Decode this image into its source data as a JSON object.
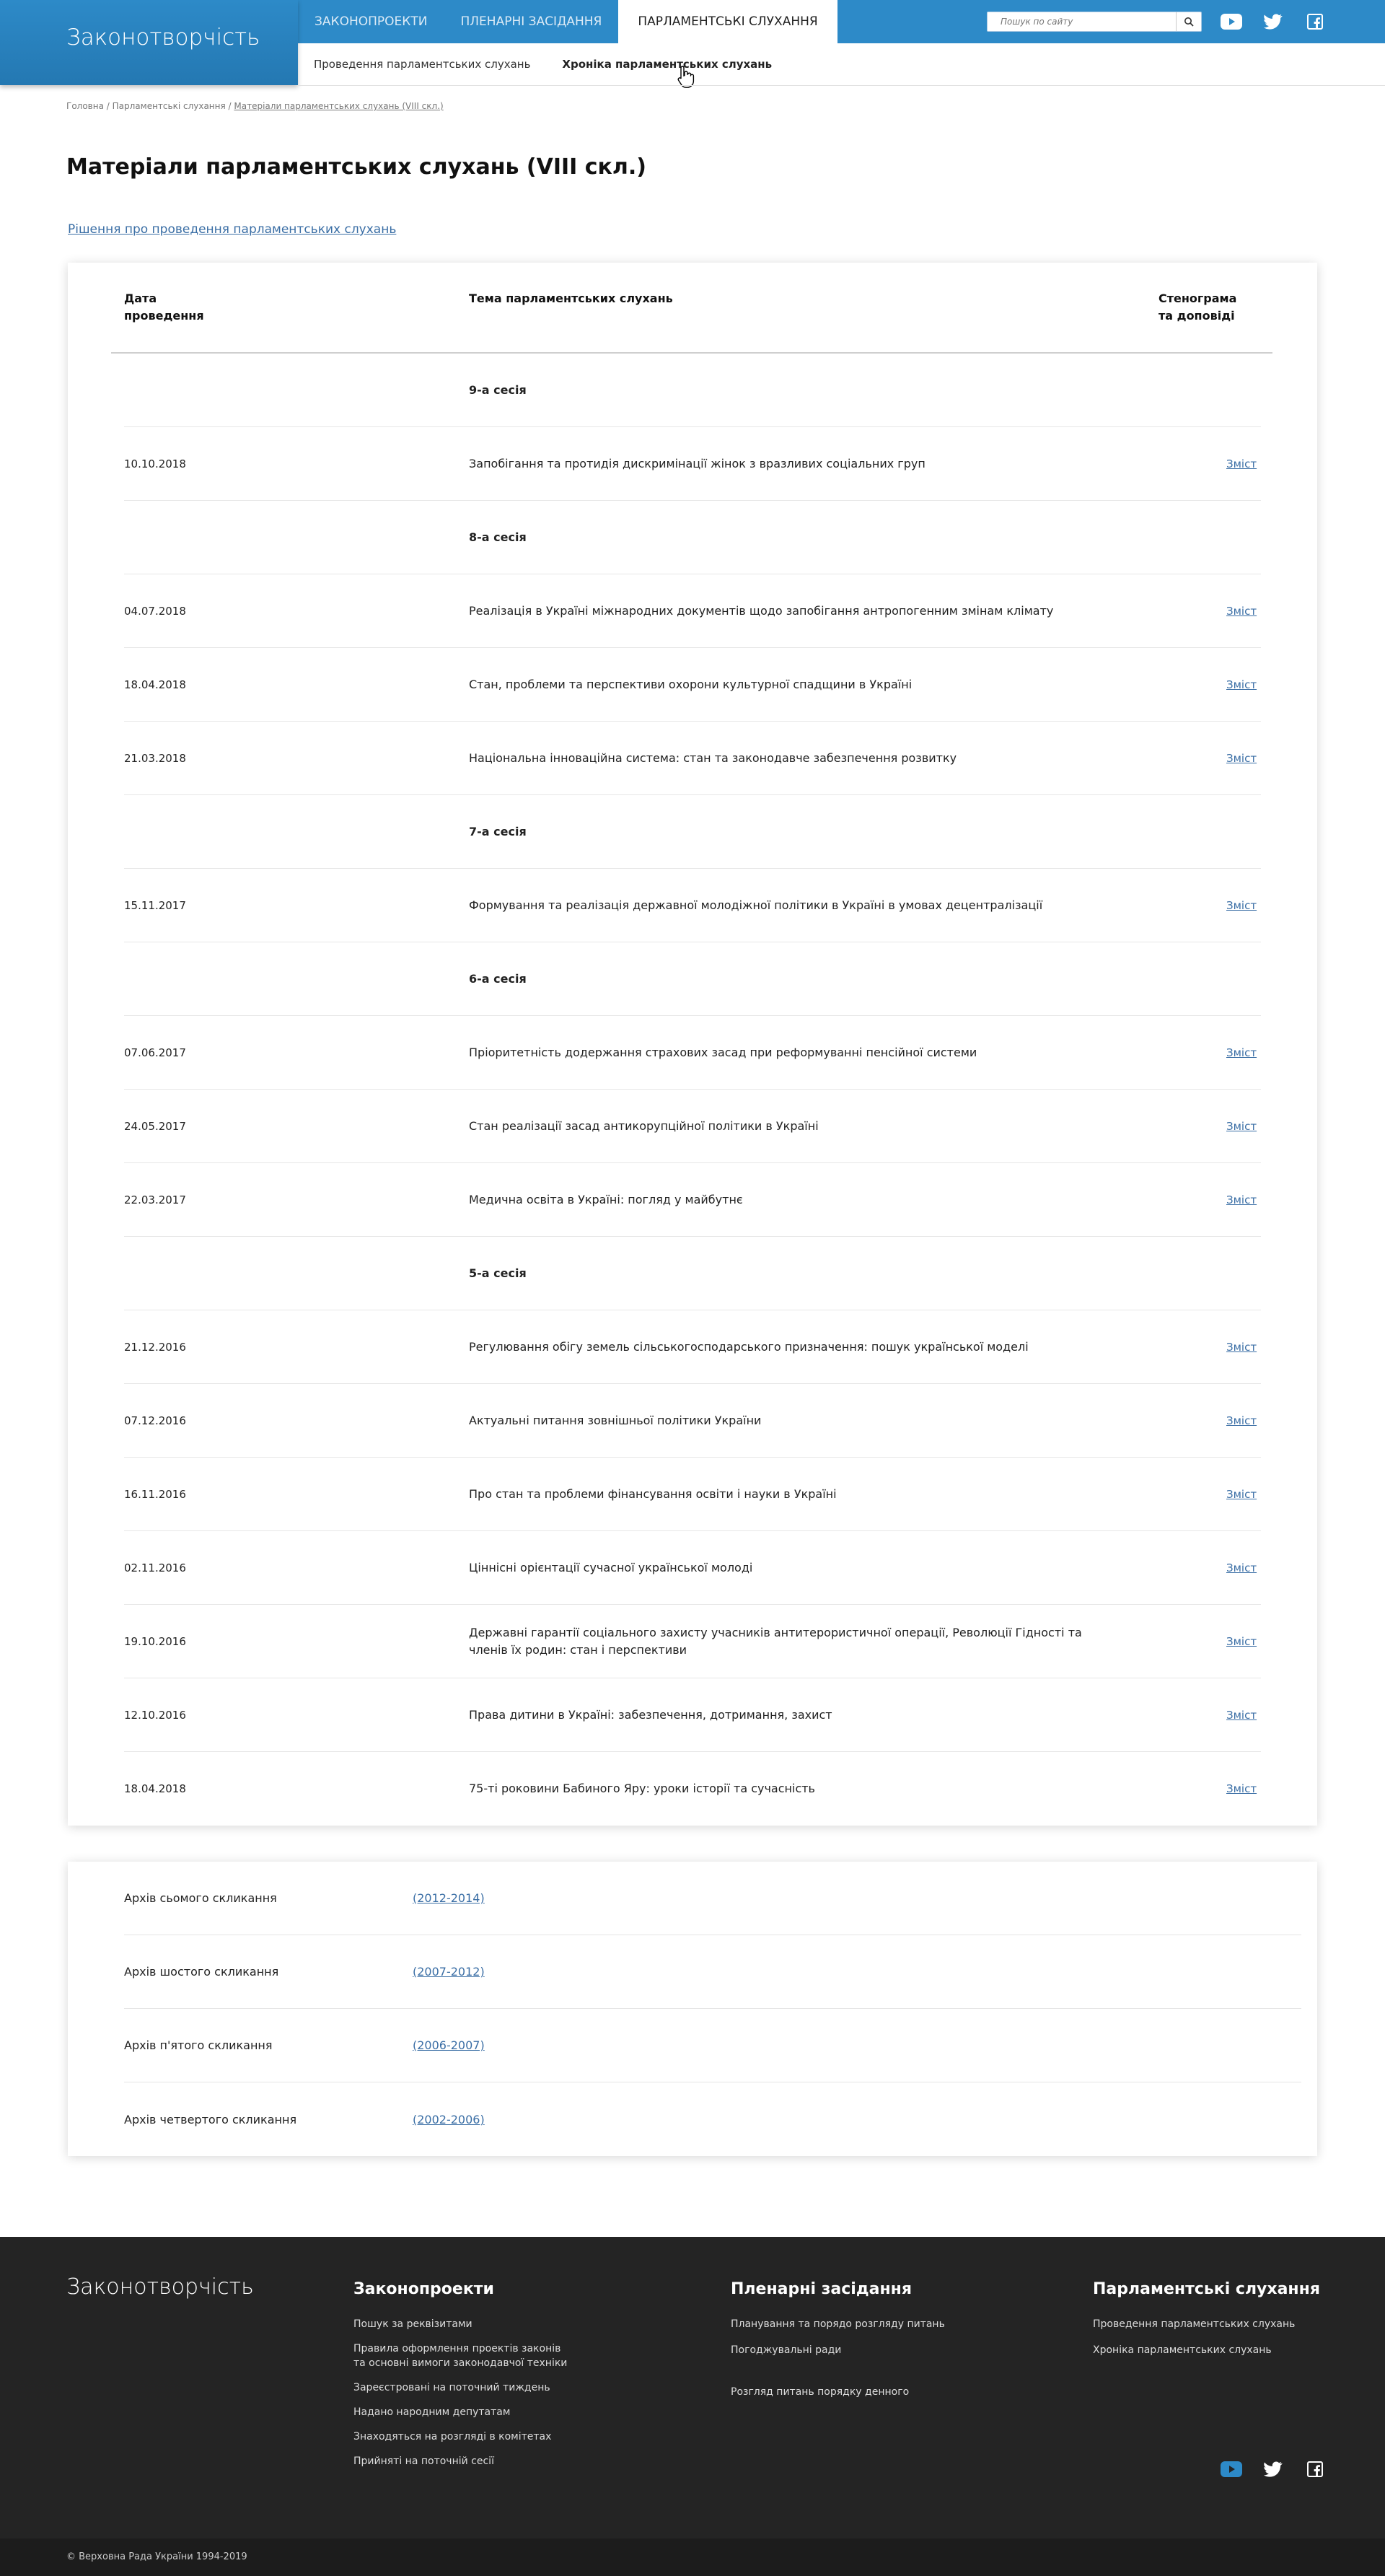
{
  "header": {
    "logo": "Законотворчість",
    "nav": [
      "ЗАКОНОПРОЕКТИ",
      "ПЛЕНАРНІ ЗАСІДАННЯ",
      "ПАРЛАМЕНТСЬКІ СЛУХАННЯ"
    ],
    "search_placeholder": "Пошук по сайту",
    "subnav": [
      "Проведення парламентських слухань",
      "Хроніка парламентських слухань"
    ]
  },
  "breadcrumb": {
    "home": "Головна",
    "section": "Парламентські слухання",
    "current": "Матеріали парламентських слухань (VIII скл.)"
  },
  "page_title": "Матеріали парламентських слухань (VIII скл.)",
  "decision_link": "Рішення про проведення парламентських слухань",
  "table": {
    "col_date_1": "Дата",
    "col_date_2": "проведення",
    "col_topic": "Тема парламентських слухань",
    "col_steno_1": "Стенограма",
    "col_steno_2": "та доповіді",
    "rows": [
      {
        "date": "",
        "topic": "9-а сесія",
        "link": "",
        "session": true
      },
      {
        "date": "10.10.2018",
        "topic": "Запобігання та протидія дискримінації жінок з вразливих соціальних груп",
        "link": "Зміст"
      },
      {
        "date": "",
        "topic": "8-а сесія",
        "link": "",
        "session": true
      },
      {
        "date": "04.07.2018",
        "topic": "Реалізація в Україні міжнародних документів щодо запобігання антропогенним змінам клімату",
        "link": "Зміст"
      },
      {
        "date": "18.04.2018",
        "topic": "Стан, проблеми та перспективи охорони культурної спадщини в Україні",
        "link": "Зміст"
      },
      {
        "date": "21.03.2018",
        "topic": "Національна інноваційна система: стан та законодавче забезпечення розвитку",
        "link": "Зміст"
      },
      {
        "date": "",
        "topic": "7-а сесія",
        "link": "",
        "session": true
      },
      {
        "date": "15.11.2017",
        "topic": "Формування та реалізація державної молодіжної політики в Україні в умовах децентралізації",
        "link": "Зміст"
      },
      {
        "date": "",
        "topic": "6-а сесія",
        "link": "",
        "session": true
      },
      {
        "date": "07.06.2017",
        "topic": "Пріоритетність додержання страхових засад при реформуванні пенсійної системи",
        "link": "Зміст"
      },
      {
        "date": "24.05.2017",
        "topic": "Стан реалізації засад антикорупційної політики в Україні",
        "link": "Зміст"
      },
      {
        "date": "22.03.2017",
        "topic": "Медична освіта в Україні: погляд у майбутнє",
        "link": "Зміст"
      },
      {
        "date": "",
        "topic": "5-а сесія",
        "link": "",
        "session": true
      },
      {
        "date": "21.12.2016",
        "topic": "Регулювання обігу земель сільськогосподарського призначення: пошук української моделі",
        "link": "Зміст"
      },
      {
        "date": "07.12.2016",
        "topic": "Актуальні питання зовнішньої політики України",
        "link": "Зміст"
      },
      {
        "date": "16.11.2016",
        "topic": "Про стан та проблеми фінансування освіти і науки в Україні",
        "link": "Зміст"
      },
      {
        "date": "02.11.2016",
        "topic": "Ціннісні орієнтації сучасної української молоді",
        "link": "Зміст"
      },
      {
        "date": "19.10.2016",
        "topic": "Державні гарантії соціального захисту учасників антитерористичної операції, Революції Гідності та членів їх родин: стан і перспективи",
        "link": "Зміст"
      },
      {
        "date": "12.10.2016",
        "topic": "Права дитини в Україні: забезпечення, дотримання, захист",
        "link": "Зміст"
      },
      {
        "date": "18.04.2018",
        "topic": "75-ті роковини Бабиного Яру: уроки історії та сучасність",
        "link": "Зміст"
      }
    ]
  },
  "archive": [
    {
      "label": "Архів сьомого скликання",
      "range": "(2012-2014)"
    },
    {
      "label": "Архів шостого скликання",
      "range": "(2007-2012)"
    },
    {
      "label": "Архів п'ятого скликання",
      "range": "(2006-2007)"
    },
    {
      "label": "Архів четвертого скликання",
      "range": "(2002-2006)"
    }
  ],
  "footer": {
    "logo": "Законотворчість",
    "col1_title": "Законопроекти",
    "col1": [
      "Пошук за реквізитами",
      "Правила оформлення проектів законів та основні вимоги законодавчої техніки",
      "Зареєстровані на поточний тиждень",
      "Надано народним депутатам",
      "Знаходяться на розгляді в комітетах",
      "Прийняті на поточній сесії"
    ],
    "col2_title": "Пленарні засідання",
    "col2": [
      "Планування та порядо розгляду питань",
      "Погоджувальні ради",
      "Розгляд питань порядку денного"
    ],
    "col3_title": "Парламентські слухання",
    "col3": [
      "Проведення парламентських слухань",
      "Хроніка парламентських слухань"
    ],
    "copyright": "© Верховна Рада України 1994-2019"
  },
  "icons": {
    "youtube": "youtube-icon",
    "twitter": "twitter-icon",
    "facebook": "facebook-icon",
    "search": "search-icon"
  }
}
